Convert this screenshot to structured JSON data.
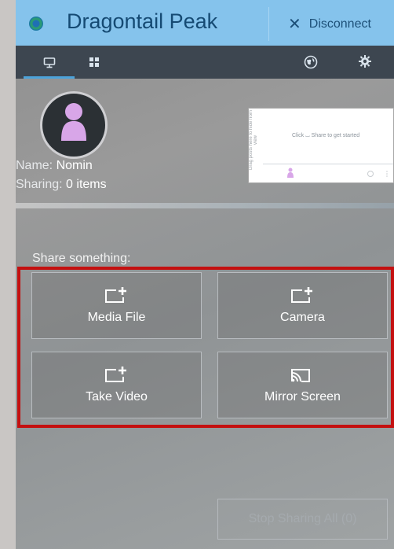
{
  "header": {
    "app_title": "Dragontail Peak",
    "disconnect_label": "Disconnect"
  },
  "tabs": [
    {
      "id": "desktop",
      "icon": "desktop-icon",
      "selected": true
    },
    {
      "id": "apps",
      "icon": "grid-icon",
      "selected": false
    }
  ],
  "toolbar": {
    "globe_icon": "globe-icon",
    "settings_icon": "gear-icon"
  },
  "profile": {
    "name_label": "Name: ",
    "name_value": "Nomin",
    "sharing_label": "Sharing: ",
    "sharing_value": "0 items"
  },
  "preview": {
    "side_text": "Drag posts here to hide from view",
    "message": "Click ⌴ Share to get started"
  },
  "share": {
    "heading": "Share something:",
    "tiles": [
      {
        "label": "Media File",
        "icon": "add-screen-icon"
      },
      {
        "label": "Camera",
        "icon": "add-screen-icon"
      },
      {
        "label": "Take Video",
        "icon": "add-screen-icon"
      },
      {
        "label": "Mirror Screen",
        "icon": "cast-icon"
      }
    ]
  },
  "footer": {
    "stop_all_label": "Stop Sharing All (0)"
  },
  "colors": {
    "title_bar": "#85c3ec",
    "tab_bar": "#3d4650",
    "highlight_frame": "#c41010",
    "avatar_figure": "#d8a6e8"
  }
}
